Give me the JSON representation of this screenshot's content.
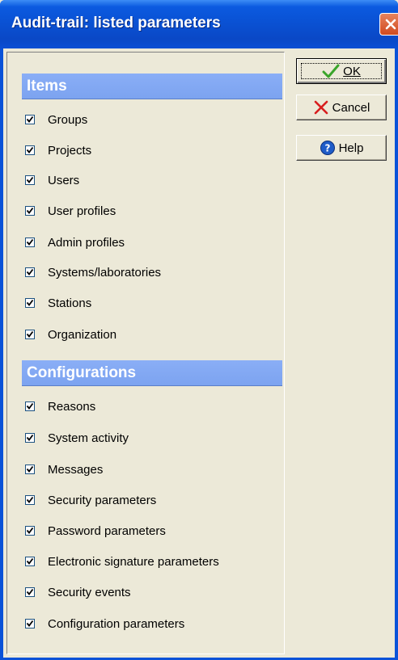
{
  "window": {
    "title": "Audit-trail: listed parameters"
  },
  "colors": {
    "titlebar": "#0a4fd0",
    "section_header": "#7ca3f0",
    "face": "#ece9d8",
    "close": "#d04a1f"
  },
  "sections": [
    {
      "title": "Items",
      "items": [
        {
          "label": "Groups",
          "checked": true
        },
        {
          "label": "Projects",
          "checked": true
        },
        {
          "label": "Users",
          "checked": true
        },
        {
          "label": "User profiles",
          "checked": true
        },
        {
          "label": "Admin profiles",
          "checked": true
        },
        {
          "label": "Systems/laboratories",
          "checked": true
        },
        {
          "label": "Stations",
          "checked": true
        },
        {
          "label": "Organization",
          "checked": true
        }
      ]
    },
    {
      "title": "Configurations",
      "items": [
        {
          "label": "Reasons",
          "checked": true
        },
        {
          "label": "System activity",
          "checked": true
        },
        {
          "label": "Messages",
          "checked": true
        },
        {
          "label": "Security parameters",
          "checked": true
        },
        {
          "label": "Password parameters",
          "checked": true
        },
        {
          "label": "Electronic signature parameters",
          "checked": true
        },
        {
          "label": "Security events",
          "checked": true
        },
        {
          "label": "Configuration parameters",
          "checked": true
        }
      ]
    }
  ],
  "buttons": {
    "ok": {
      "label": "OK",
      "icon": "checkmark-icon"
    },
    "cancel": {
      "label": "Cancel",
      "icon": "cross-icon"
    },
    "help": {
      "label": "Help",
      "icon": "help-icon"
    }
  }
}
